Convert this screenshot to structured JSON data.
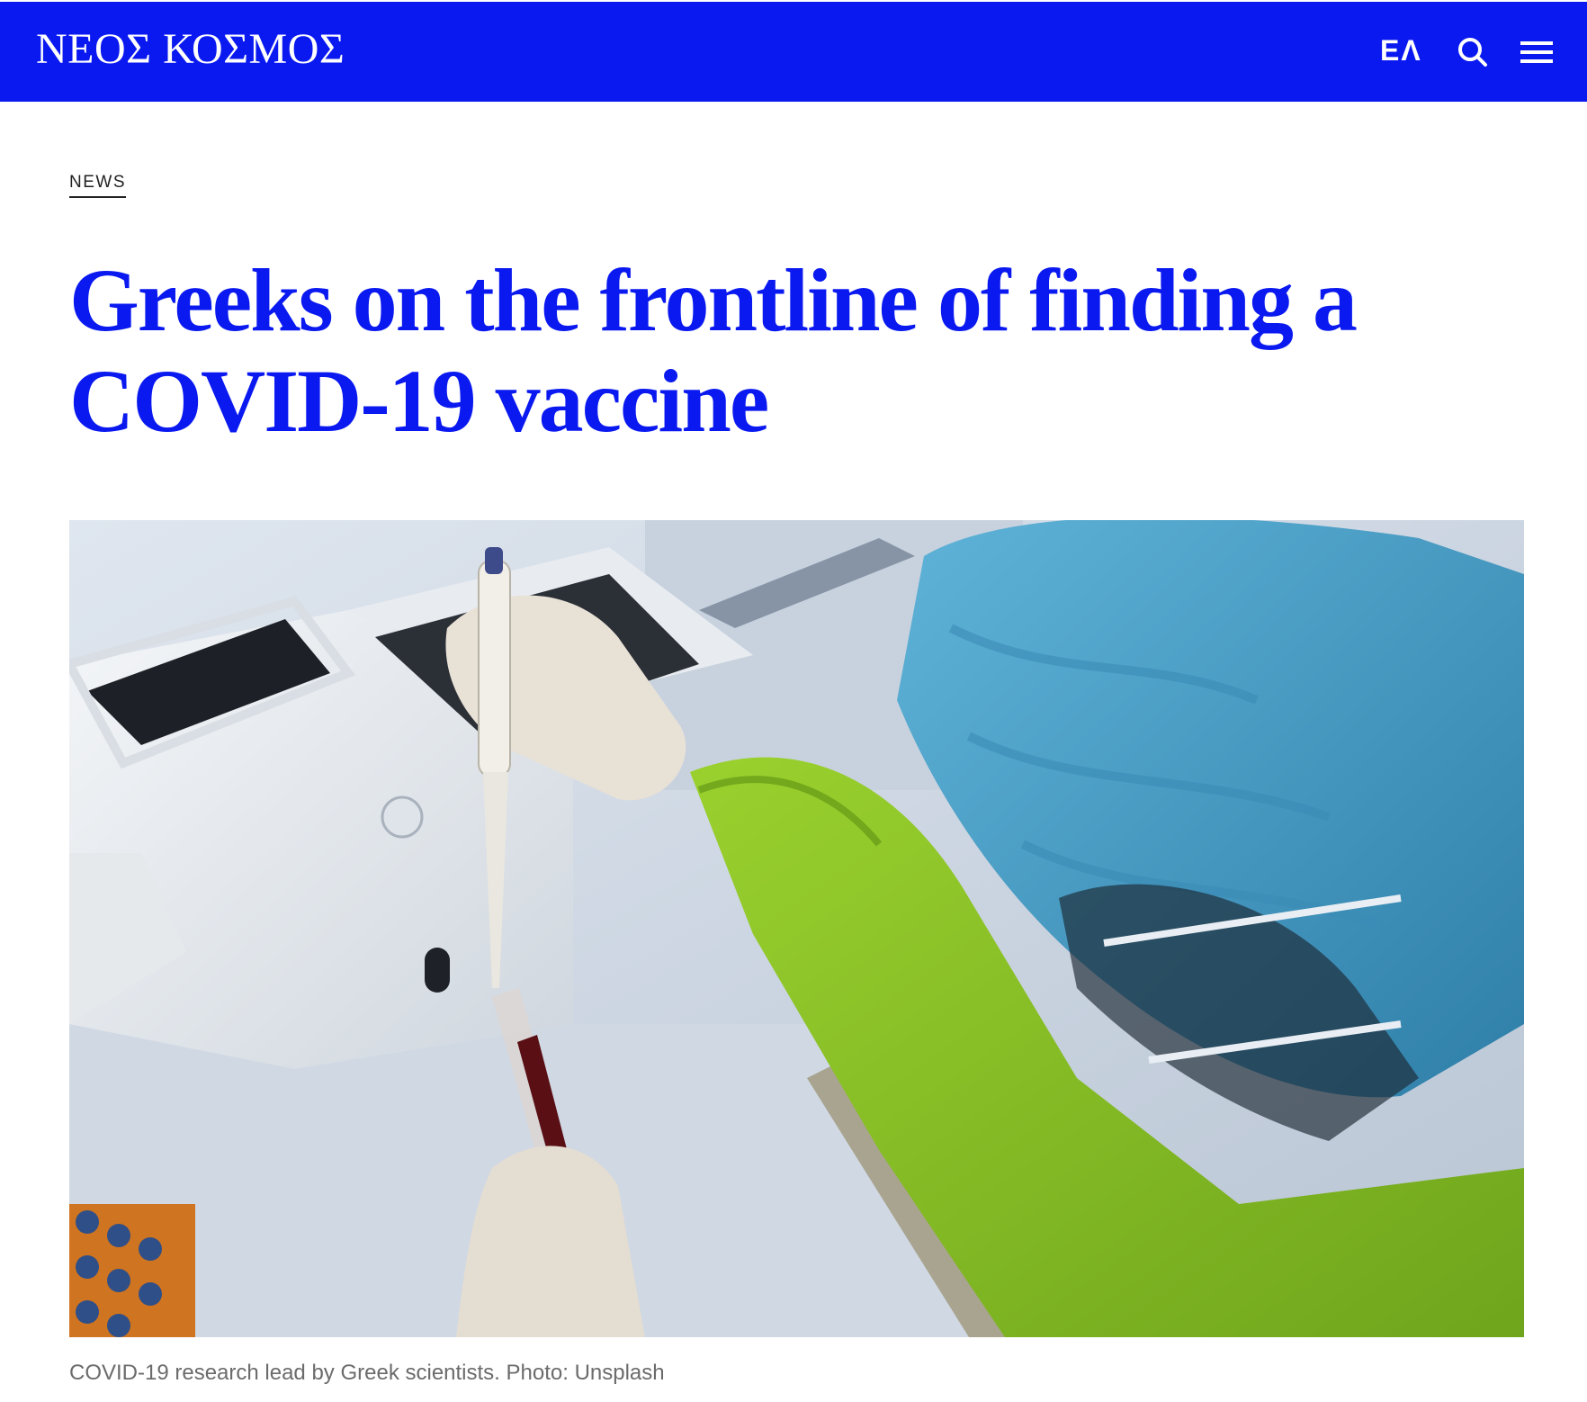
{
  "header": {
    "logo": "ΝΕΟΣ ΚΟΣΜΟΣ",
    "language_toggle": "ΕΛ",
    "background_color": "#0a19f0",
    "icons": [
      "search-icon",
      "menu-icon"
    ]
  },
  "article": {
    "category": "NEWS",
    "headline": "Greeks on the frontline of finding a COVID-19 vaccine",
    "headline_color": "#0a19f0",
    "image_caption": "COVID-19 research lead by Greek scientists. Photo: Unsplash"
  }
}
